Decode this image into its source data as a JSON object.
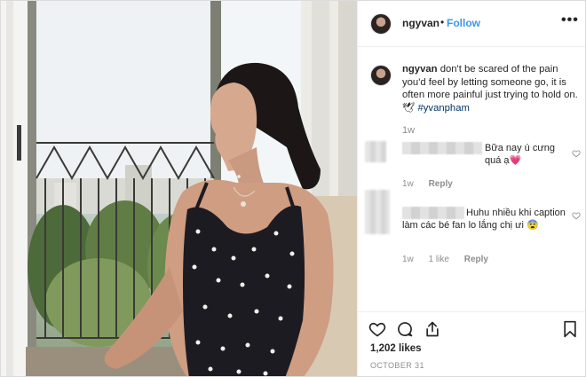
{
  "header": {
    "username": "ngyvan",
    "separator": "•",
    "follow_label": "Follow",
    "more_label": "•••"
  },
  "caption": {
    "username": "ngyvan",
    "text": "don't be scared of the pain you'd feel by letting someone go, it is often more painful just trying to hold on. 🕊",
    "hashtag": "#yvanpham",
    "time": "1w"
  },
  "comments": [
    {
      "text": "Bữa nay ú cưng quá ạ💗",
      "time": "1w",
      "reply_label": "Reply"
    },
    {
      "text": "Huhu nhiều khi caption làm các bé fan lo lắng chị ưi 😨",
      "time": "1w",
      "likes_label": "1 like",
      "reply_label": "Reply"
    }
  ],
  "actions": {
    "likes_text": "1,202 likes",
    "date_text": "OCTOBER 31",
    "icons": [
      "heart-icon",
      "comment-icon",
      "share-icon",
      "bookmark-icon"
    ]
  },
  "colors": {
    "link_blue": "#3897f0",
    "hashtag": "#003569",
    "muted": "#8e8e8e",
    "text": "#262626"
  }
}
